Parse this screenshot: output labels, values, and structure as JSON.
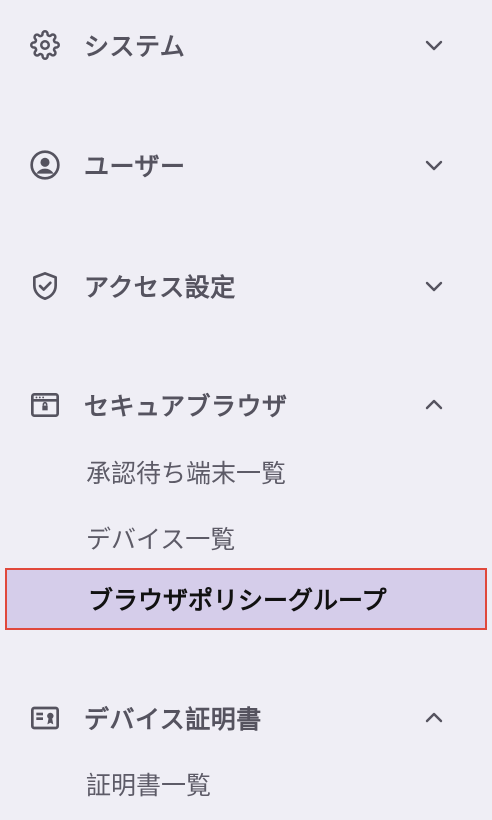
{
  "sidebar": {
    "sections": [
      {
        "label": "システム",
        "icon": "gear-icon",
        "chevron": "chevron-down-icon"
      },
      {
        "label": "ユーザー",
        "icon": "user-circle-icon",
        "chevron": "chevron-down-icon"
      },
      {
        "label": "アクセス設定",
        "icon": "shield-check-icon",
        "chevron": "chevron-down-icon"
      },
      {
        "label": "セキュアブラウザ",
        "icon": "browser-window-icon",
        "chevron": "chevron-up-icon",
        "items": [
          {
            "label": "承認待ち端末一覧"
          },
          {
            "label": "デバイス一覧"
          },
          {
            "label": "ブラウザポリシーグループ",
            "active": true
          }
        ]
      },
      {
        "label": "デバイス証明書",
        "icon": "certificate-icon",
        "chevron": "chevron-up-icon",
        "items": [
          {
            "label": "証明書一覧"
          }
        ]
      }
    ]
  },
  "colors": {
    "background": "#efeef5",
    "active_background": "#d5cdea",
    "active_border": "#e0483c",
    "section_text": "#55535f",
    "item_text": "#5d5b67",
    "active_text": "#111111"
  }
}
